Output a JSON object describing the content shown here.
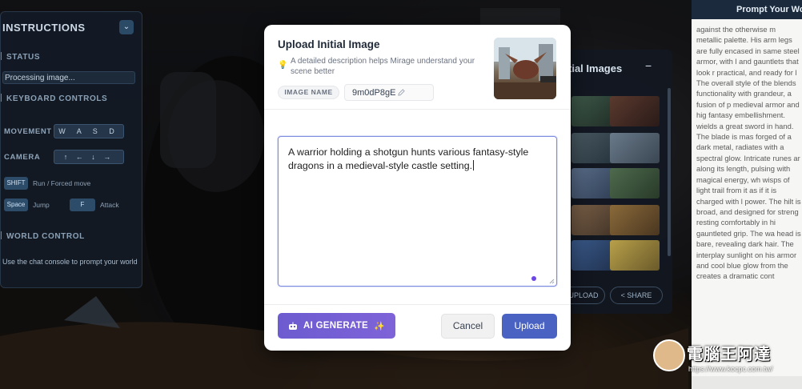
{
  "background_panels": {
    "instructions": {
      "title": "INSTRUCTIONS",
      "status_label": "STATUS",
      "status_value": "Processing image...",
      "keyboard_label": "KEYBOARD CONTROLS",
      "movement_label": "MOVEMENT",
      "movement_keys": "W A S D",
      "camera_label": "CAMERA",
      "camera_keys": "↑ ← ↓ →",
      "shift_key": "SHIFT",
      "shift_action": "Run / Forced move",
      "space_key": "Space",
      "space_action": "Jump",
      "f_key": "F",
      "f_action": "Attack",
      "world_label": "WORLD CONTROL",
      "world_hint": "Use the chat console to prompt your world"
    },
    "images_panel": {
      "title": "tial Images",
      "upload_button": "UPLOAD",
      "share_button": "< SHARE"
    },
    "prompt_panel": {
      "title": "Prompt Your Wo",
      "text": "against the otherwise m metallic palette. His arm legs are fully encased in same steel armor, with l and gauntlets that look r practical, and ready for l The overall style of the blends functionality with grandeur, a fusion of p medieval armor and hig fantasy embellishment. wields a great sword in hand. The blade is mas forged of a dark metal, radiates with a spectral glow. Intricate runes ar along its length, pulsing with magical energy, wh wisps of light trail from it as if it is charged with l power. The hilt is broad, and designed for streng resting comfortably in hi gauntleted grip. The wa head is bare, revealing dark hair. The interplay sunlight on his armor and cool blue glow from the creates a dramatic cont"
    },
    "watermark": {
      "name": "電腦王阿達",
      "url": "https://www.kocpc.com.tw/"
    }
  },
  "modal": {
    "title": "Upload Initial Image",
    "hint": "A detailed description helps Mirage understand your scene better",
    "image_name_label": "IMAGE NAME",
    "image_name_value": "9m0dP8gE",
    "description": "A warrior holding a shotgun hunts various fantasy-style dragons in a medieval-style castle setting.",
    "ai_generate_label": "AI GENERATE",
    "cancel_label": "Cancel",
    "upload_label": "Upload"
  },
  "colors": {
    "accent": "#4a63c2",
    "ai_button": "#7260d4",
    "focus_border": "#7c8ce0"
  }
}
